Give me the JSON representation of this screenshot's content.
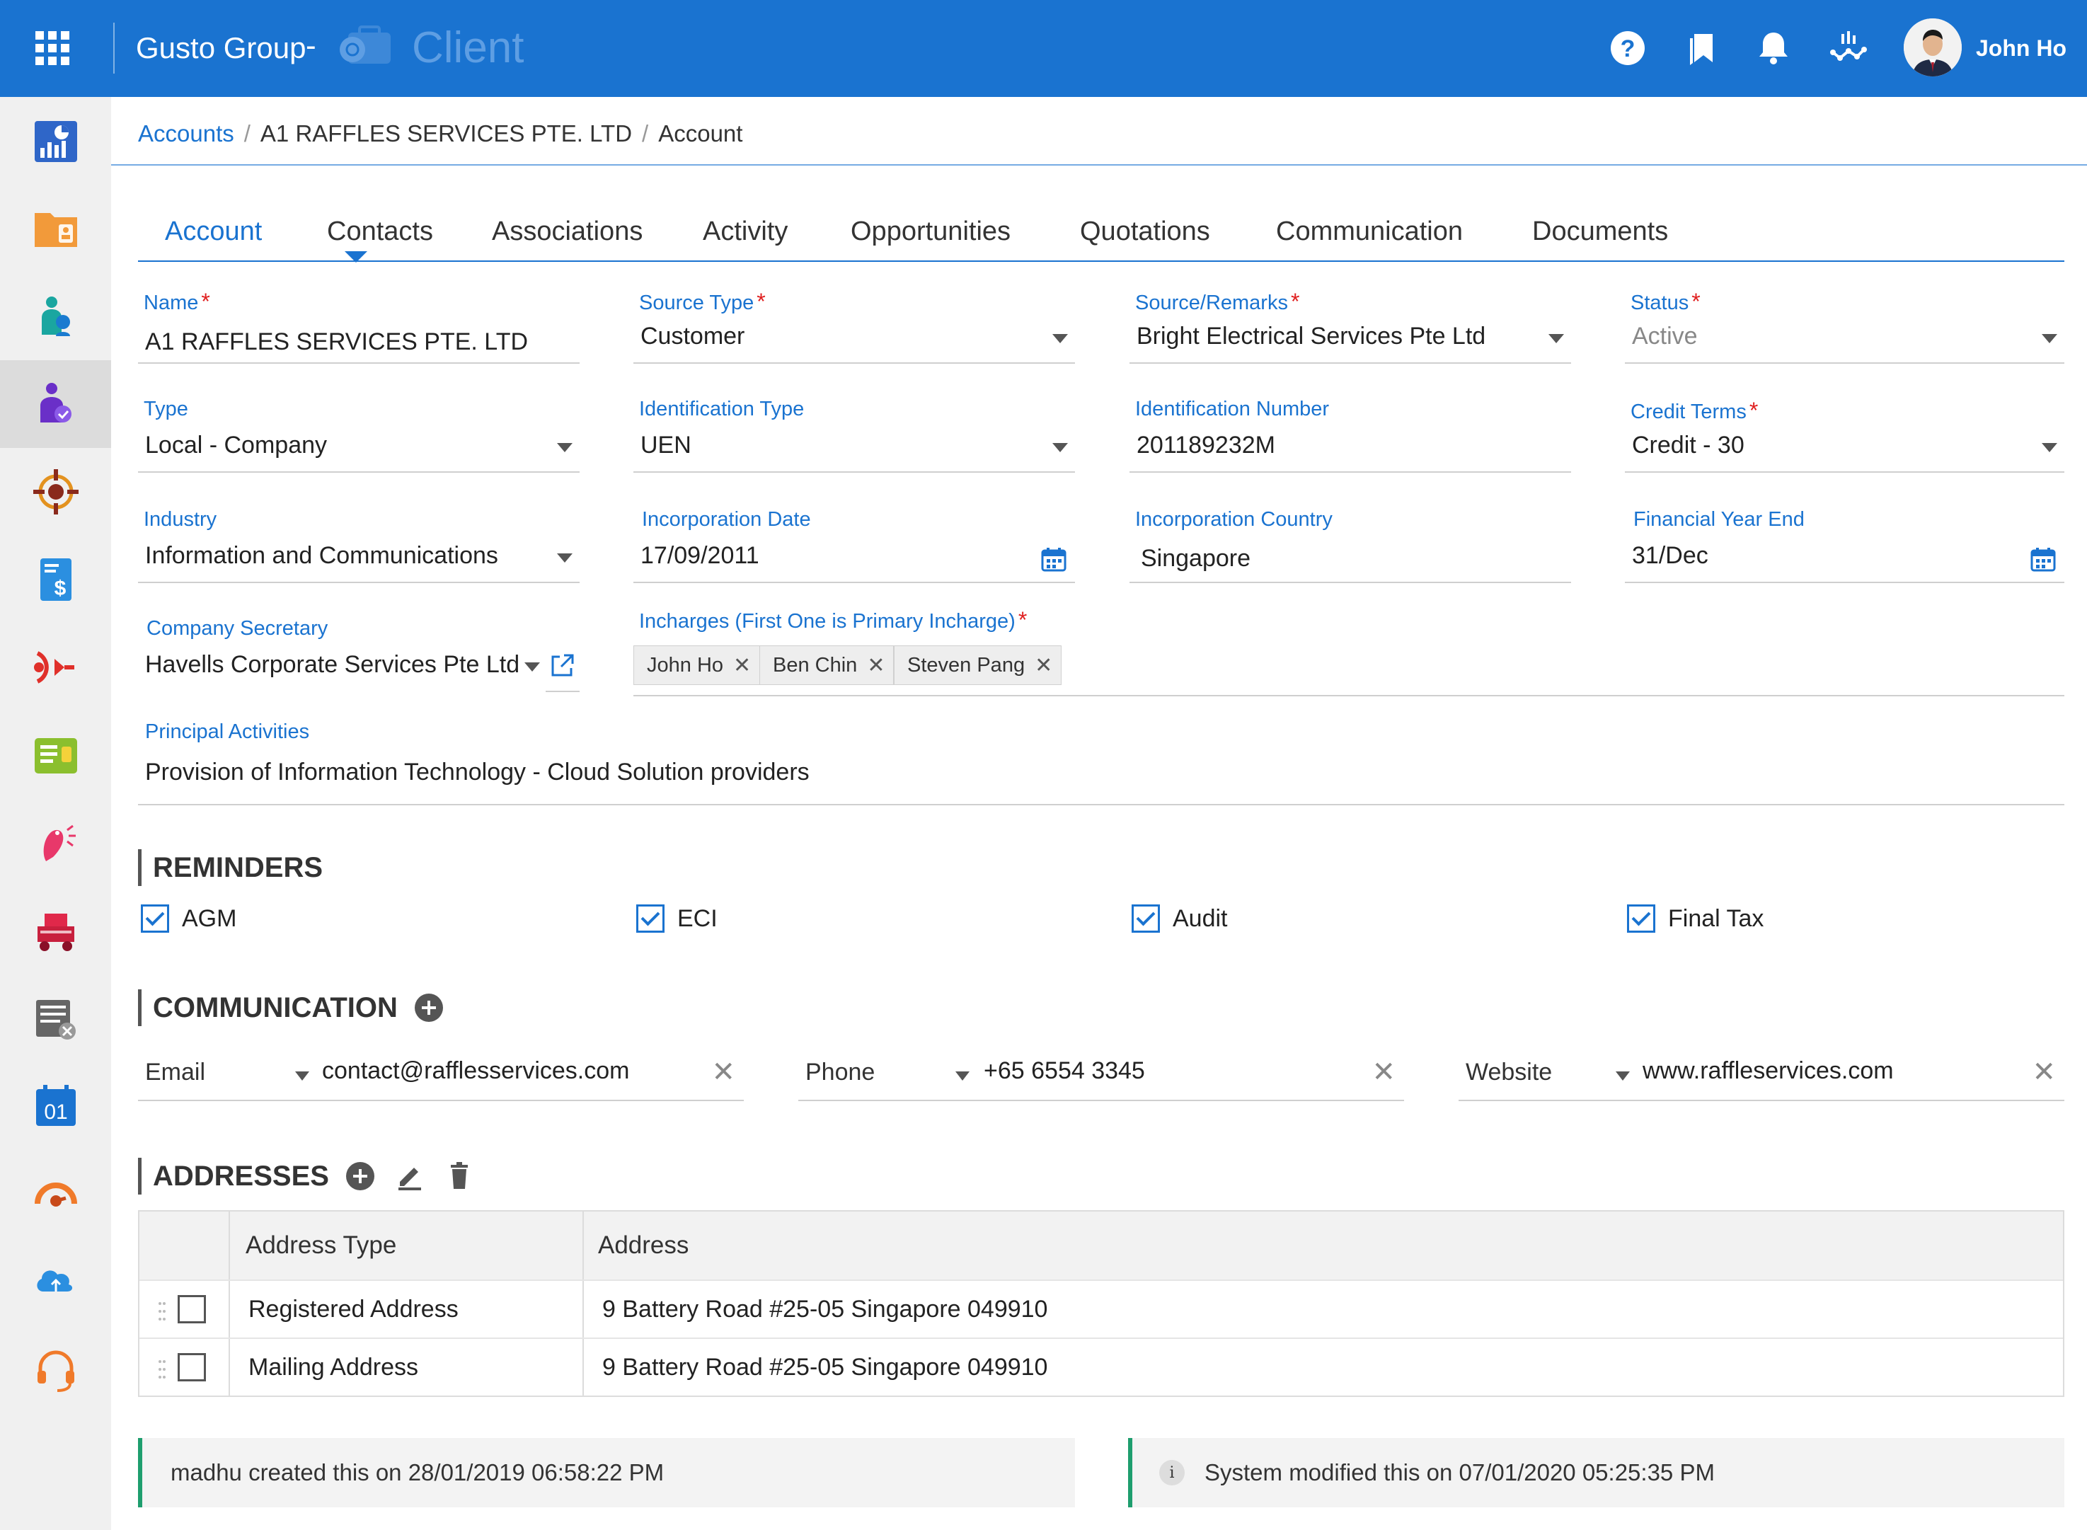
{
  "header": {
    "brand": "Gusto Group",
    "dash": "-",
    "module": "Client",
    "user_name": "John Ho",
    "icons": [
      "apps-grid-icon",
      "help-icon",
      "bookmarks-icon",
      "notification-bell-icon",
      "analytics-icon"
    ]
  },
  "sidebar": {
    "items": [
      {
        "name": "dashboard-icon"
      },
      {
        "name": "folder-user-icon"
      },
      {
        "name": "people-icon"
      },
      {
        "name": "client-user-icon",
        "active": true
      },
      {
        "name": "target-icon"
      },
      {
        "name": "invoice-dollar-icon"
      },
      {
        "name": "broadcast-icon"
      },
      {
        "name": "id-card-icon"
      },
      {
        "name": "bird-icon"
      },
      {
        "name": "vehicle-icon"
      },
      {
        "name": "document-cancel-icon"
      },
      {
        "name": "calendar-01-icon",
        "label": "01"
      },
      {
        "name": "speed-gauge-icon"
      },
      {
        "name": "cloud-sync-icon"
      },
      {
        "name": "headset-support-icon"
      }
    ]
  },
  "breadcrumb": {
    "root": "Accounts",
    "company": "A1 RAFFLES SERVICES PTE. LTD",
    "current": "Account",
    "separator": "/"
  },
  "tabs": [
    "Account",
    "Contacts",
    "Associations",
    "Activity",
    "Opportunities",
    "Quotations",
    "Communication",
    "Documents"
  ],
  "form": {
    "required_mark": "*",
    "name": {
      "label": "Name",
      "value": "A1 RAFFLES SERVICES PTE. LTD"
    },
    "source_type": {
      "label": "Source Type",
      "value": "Customer"
    },
    "source_remarks": {
      "label": "Source/Remarks",
      "value": "Bright Electrical Services Pte Ltd"
    },
    "status": {
      "label": "Status",
      "value": "Active"
    },
    "type": {
      "label": "Type",
      "value": "Local - Company"
    },
    "identification_type": {
      "label": "Identification Type",
      "value": "UEN"
    },
    "identification_number": {
      "label": "Identification Number",
      "value": "201189232M"
    },
    "credit_terms": {
      "label": "Credit Terms",
      "value": "Credit - 30"
    },
    "industry": {
      "label": "Industry",
      "value": "Information and Communications"
    },
    "incorporation_date": {
      "label": "Incorporation Date",
      "value": "17/09/2011"
    },
    "incorporation_country": {
      "label": "Incorporation Country",
      "value": "Singapore"
    },
    "financial_year_end": {
      "label": "Financial Year End",
      "value": "31/Dec"
    },
    "company_secretary": {
      "label": "Company Secretary",
      "value": "Havells Corporate Services Pte Ltd"
    },
    "incharges": {
      "label": "Incharges (First One is Primary Incharge)",
      "chips": [
        "John Ho",
        "Ben Chin",
        "Steven Pang"
      ]
    },
    "principal_activities": {
      "label": "Principal Activities",
      "value": "Provision of Information Technology - Cloud Solution providers"
    }
  },
  "reminders": {
    "title": "REMINDERS",
    "items": [
      "AGM",
      "ECI",
      "Audit",
      "Final Tax"
    ]
  },
  "communication": {
    "title": "COMMUNICATION",
    "rows": [
      {
        "type": "Email",
        "value": "contact@rafflesservices.com"
      },
      {
        "type": "Phone",
        "value": "+65 6554 3345"
      },
      {
        "type": "Website",
        "value": "www.raffleservices.com"
      }
    ]
  },
  "addresses": {
    "title": "ADDRESSES",
    "columns": [
      "Address Type",
      "Address"
    ],
    "rows": [
      {
        "type": "Registered Address",
        "address": "9 Battery Road #25-05 Singapore 049910"
      },
      {
        "type": "Mailing Address",
        "address": "9 Battery Road #25-05 Singapore 049910"
      }
    ]
  },
  "audit": {
    "created": "madhu created this on 28/01/2019 06:58:22 PM",
    "modified": "System modified this on 07/01/2020 05:25:35 PM",
    "info_glyph": "i"
  },
  "colors": {
    "primary": "#1a73d0",
    "required": "#e02020",
    "audit_accent": "#1e9e6e"
  }
}
